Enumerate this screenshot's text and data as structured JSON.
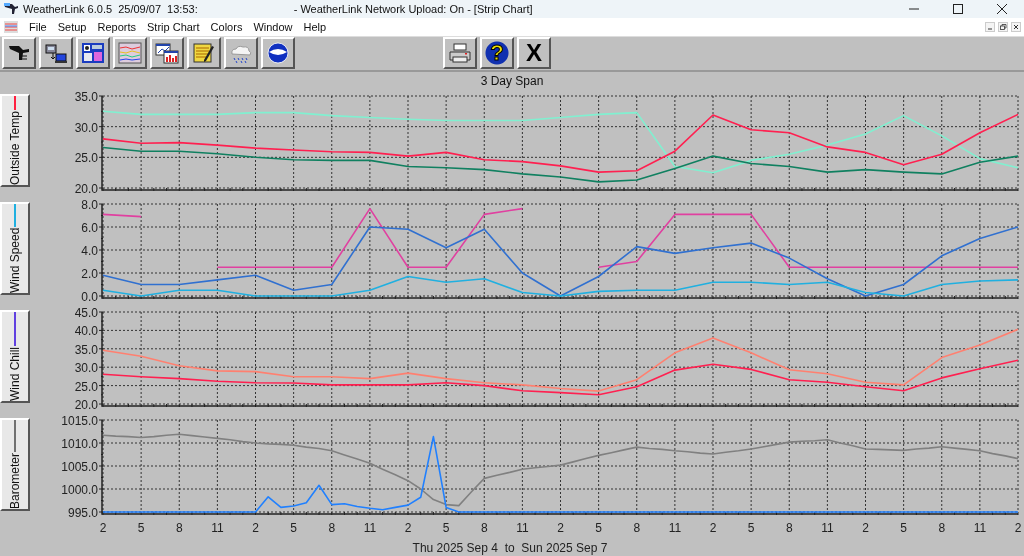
{
  "window": {
    "title": "WeatherLink 6.0.5  25/09/07  13:53:",
    "upload_status": "- WeatherLink Network Upload: On - [Strip Chart]"
  },
  "menu": [
    "File",
    "Setup",
    "Reports",
    "Strip Chart",
    "Colors",
    "Window",
    "Help"
  ],
  "toolbar": {
    "help_glyph": "?",
    "close_glyph": "X"
  },
  "strip_chart": {
    "title": "3 Day Span",
    "panels": [
      {
        "label": "Outside Temp",
        "color": "#ff2040",
        "chart_data": {
          "type": "line",
          "grid": true,
          "categories": [
            null,
            null,
            null,
            null,
            null,
            null,
            null,
            null,
            null,
            null,
            null,
            null,
            null,
            null,
            null,
            null,
            null,
            null,
            null,
            null,
            null,
            null,
            null,
            null,
            null
          ],
          "ylim": [
            20,
            35
          ],
          "yticks": [
            {
              "value": 20,
              "label": "20.0"
            },
            {
              "value": 25,
              "label": "25.0"
            },
            {
              "value": 30,
              "label": "30.0"
            },
            {
              "value": 35,
              "label": "35.0"
            }
          ],
          "series": [
            {
              "color": "#80f0d0",
              "values": [
                32.5,
                32,
                32,
                32,
                32.3,
                32.3,
                31.8,
                31.5,
                31.2,
                31,
                31,
                31,
                31.5,
                32,
                32.3,
                23.5,
                22.5,
                24.5,
                25.5,
                27,
                28.8,
                31.8,
                28.5,
                24.8,
                23.3
              ]
            },
            {
              "color": "#ff2050",
              "values": [
                28,
                27.3,
                27.4,
                27,
                26.5,
                26.2,
                25.9,
                25.8,
                25.2,
                25.8,
                24.6,
                24.3,
                23.6,
                22.6,
                22.8,
                26,
                31.9,
                29.5,
                29,
                26.7,
                25.8,
                23.8,
                25.5,
                29,
                32
              ]
            },
            {
              "color": "#108060",
              "values": [
                26.6,
                26,
                26,
                25.6,
                25,
                24.6,
                24.5,
                24.5,
                23.5,
                23.3,
                23,
                22.3,
                21.8,
                21,
                21.3,
                23.2,
                25.2,
                24,
                23.5,
                22.6,
                23,
                22.6,
                22.3,
                24.2,
                25.2
              ]
            }
          ]
        }
      },
      {
        "label": "Wind Speed",
        "color": "#20b0e0",
        "chart_data": {
          "type": "line",
          "grid": true,
          "categories": [
            null,
            null,
            null,
            null,
            null,
            null,
            null,
            null,
            null,
            null,
            null,
            null,
            null,
            null,
            null,
            null,
            null,
            null,
            null,
            null,
            null,
            null,
            null,
            null,
            null
          ],
          "ylim": [
            0,
            8
          ],
          "yticks": [
            {
              "value": 0,
              "label": "0.0"
            },
            {
              "value": 2,
              "label": "2.0"
            },
            {
              "value": 4,
              "label": "4.0"
            },
            {
              "value": 6,
              "label": "6.0"
            },
            {
              "value": 8,
              "label": "8.0"
            }
          ],
          "series": [
            {
              "color": "#e040a0",
              "values": [
                7.1,
                6.9,
                null,
                2.5,
                2.5,
                2.5,
                2.5,
                7.6,
                2.5,
                2.5,
                7.1,
                7.6,
                null,
                2.5,
                3.0,
                7.1,
                7.1,
                7.1,
                2.5,
                2.5,
                2.5,
                2.5,
                2.5,
                2.5,
                2.5
              ]
            },
            {
              "color": "#3070d0",
              "values": [
                1.8,
                1.0,
                1.0,
                1.4,
                1.8,
                0.5,
                1.0,
                6.0,
                5.8,
                4.2,
                5.8,
                2.0,
                0,
                1.7,
                4.3,
                3.7,
                4.2,
                4.6,
                3.3,
                1.5,
                0,
                1.0,
                3.5,
                5.0,
                6.0
              ]
            },
            {
              "color": "#20b0e0",
              "values": [
                0.5,
                0,
                0.5,
                0.5,
                0,
                0,
                0,
                0.5,
                1.7,
                1.2,
                1.5,
                0.3,
                0,
                0.4,
                0.5,
                0.5,
                1.2,
                1.2,
                1.0,
                1.2,
                0.3,
                0,
                1.0,
                1.3,
                1.4
              ]
            }
          ]
        }
      },
      {
        "label": "Wind Chill",
        "color": "#6040e0",
        "chart_data": {
          "type": "line",
          "grid": true,
          "categories": [
            null,
            null,
            null,
            null,
            null,
            null,
            null,
            null,
            null,
            null,
            null,
            null,
            null,
            null,
            null,
            null,
            null,
            null,
            null,
            null,
            null,
            null,
            null,
            null,
            null
          ],
          "ylim": [
            20,
            45
          ],
          "yticks": [
            {
              "value": 20,
              "label": "20.0"
            },
            {
              "value": 25,
              "label": "25.0"
            },
            {
              "value": 30,
              "label": "30.0"
            },
            {
              "value": 35,
              "label": "35.0"
            },
            {
              "value": 40,
              "label": "40.0"
            },
            {
              "value": 45,
              "label": "45.0"
            }
          ],
          "series": [
            {
              "color": "#ff8070",
              "values": [
                34.6,
                33.0,
                30.4,
                29.0,
                28.8,
                27.4,
                27.4,
                26.9,
                28.4,
                26.9,
                25.8,
                25.2,
                24.2,
                23.5,
                26.6,
                33.9,
                37.9,
                33.9,
                29.3,
                28.2,
                25.9,
                25.2,
                32.6,
                36,
                40.3
              ]
            },
            {
              "color": "#ff2050",
              "values": [
                28.1,
                27.4,
                26.9,
                26.2,
                25.8,
                25.7,
                25.2,
                25.2,
                25.2,
                25.8,
                25.0,
                23.6,
                23.1,
                22.5,
                24.7,
                29.2,
                30.8,
                29.4,
                26.6,
                25.9,
                24.7,
                23.6,
                27.1,
                29.6,
                31.9
              ]
            }
          ]
        }
      },
      {
        "label": "Barometer",
        "color": "#707070",
        "chart_data": {
          "type": "line",
          "grid": true,
          "xlabel": "Thu 2025 Sep 4  to  Sun 2025 Sep 7",
          "categories": [
            "2",
            null,
            null,
            "5",
            null,
            null,
            "8",
            null,
            null,
            "11",
            null,
            null,
            "2",
            null,
            null,
            "5",
            null,
            null,
            "8",
            null,
            null,
            "11",
            null,
            null,
            "2",
            null,
            null,
            "5",
            null,
            null,
            "8",
            null,
            null,
            "11",
            null,
            null,
            "2",
            null,
            null,
            "5",
            null,
            null,
            "8",
            null,
            null,
            "11",
            null,
            null,
            "2",
            null,
            null,
            "5",
            null,
            null,
            "8",
            null,
            null,
            "11",
            null,
            null,
            "2",
            null,
            null,
            "5",
            null,
            null,
            "8",
            null,
            null,
            "11",
            null,
            null,
            "2"
          ],
          "ylim": [
            995,
            1015
          ],
          "yticks": [
            {
              "value": 995,
              "label": "995.0"
            },
            {
              "value": 1000,
              "label": "1000.0"
            },
            {
              "value": 1005,
              "label": "1005.0"
            },
            {
              "value": 1010,
              "label": "1010.0"
            },
            {
              "value": 1015,
              "label": "1015.0"
            }
          ],
          "series": [
            {
              "color": "#808080",
              "values": [
                1011.7,
                1011.5,
                1011.4,
                1011.2,
                1011.4,
                1011.7,
                1011.9,
                1011.6,
                1011.3,
                1011.0,
                1010.7,
                1010.3,
                1010.0,
                1009.8,
                1009.7,
                1009.5,
                1009.1,
                1008.8,
                1008.3,
                1007.4,
                1006.5,
                1005.6,
                1004.3,
                1003.1,
                1001.8,
                1000.0,
                997.7,
                996.6,
                996.4,
                999.4,
                1002.3,
                1003.0,
                1003.6,
                1004.3,
                1004.6,
                1004.9,
                1005.2,
                1005.9,
                1006.6,
                1007.3,
                1007.9,
                1008.5,
                1009.1,
                1008.8,
                1008.6,
                1008.3,
                1008.1,
                1007.8,
                1007.6,
                1008.0,
                1008.3,
                1008.7,
                1009.2,
                1009.7,
                1010.2,
                1010.4,
                1010.5,
                1010.7,
                1010.0,
                1009.4,
                1008.7,
                1008.6,
                1008.5,
                1008.4,
                1008.7,
                1008.9,
                1009.2,
                1008.9,
                1008.6,
                1008.3,
                1007.7,
                1007.2,
                1006.6
              ]
            },
            {
              "color": "#2080ff",
              "values": [
                995,
                995,
                995,
                995,
                995,
                995,
                995,
                995,
                995,
                995,
                995,
                995,
                995,
                998.3,
                996.0,
                996.3,
                997.0,
                1000.8,
                996.6,
                996.8,
                996.2,
                995.8,
                995.5,
                996.0,
                996.5,
                998.2,
                1011.4,
                996.0,
                995,
                995,
                995,
                995,
                995,
                995,
                995,
                995,
                995,
                995,
                995,
                995,
                995,
                995,
                995,
                995,
                995,
                995,
                995,
                995,
                995,
                995,
                995,
                995,
                995,
                995,
                995,
                995,
                995,
                995,
                995,
                995,
                995,
                995,
                995,
                995,
                995,
                995,
                995,
                995,
                995,
                995,
                995,
                995,
                995
              ]
            }
          ]
        }
      }
    ]
  }
}
